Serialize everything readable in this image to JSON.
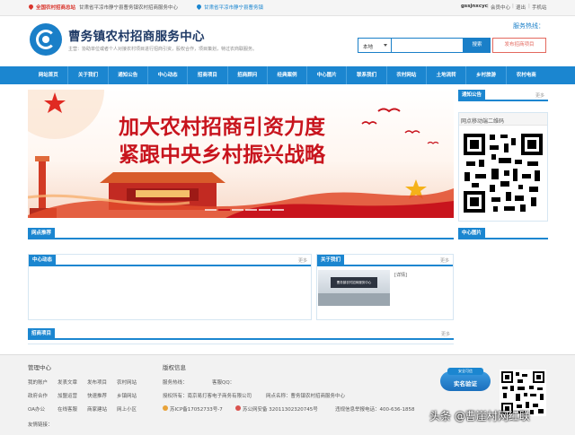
{
  "topbar": {
    "badge": "全国农村招商总站",
    "region": "甘肃省平凉市静宁县曹务镇农村招商服务中心",
    "location": "甘肃省平凉市静宁县曹务镇",
    "username": "gssjnxcyc",
    "links": [
      "会员中心",
      "退出",
      "手机站"
    ],
    "sep": "|"
  },
  "header": {
    "site_name": "曹务镇农村招商服务中心",
    "slogan": "主营：协助单位或者个人对接农村项目进行招商引资，股权合作，项目策划，特过农商联服务。",
    "hotline_label": "服务热线：",
    "publish_button": "发布招商项目"
  },
  "search": {
    "scope": "本地",
    "button": "搜索"
  },
  "nav": [
    "网站首页",
    "关于我们",
    "通知公告",
    "中心动态",
    "招商项目",
    "招商顾问",
    "经典案例",
    "中心图片",
    "联系我们",
    "农村网站",
    "土地流转",
    "乡村旅游",
    "农村电商"
  ],
  "banner": {
    "line1": "加大农村招商引资力度",
    "line2": "紧跟中央乡村振兴战略"
  },
  "sidebar": {
    "notice_title": "通知公告",
    "notice_more": "更多",
    "qr_title": "网点移动端二维码",
    "photos_title": "中心图片"
  },
  "sections": {
    "recommend_title": "网点推荐",
    "news_title": "中心动态",
    "news_more": "更多",
    "about_title": "关于我们",
    "about_more": "更多",
    "about_detail": "[详情]",
    "about_photo_caption": "曹务镇农村招商服务中心",
    "projects_title": "招商项目",
    "projects_more": "更多"
  },
  "footer": {
    "mgmt_title": "管理中心",
    "mgmt_links": [
      [
        "我的账户",
        "发表文章",
        "发布项目",
        "农村网站"
      ],
      [
        "政府合作",
        "加盟运营",
        "快速推荐",
        "乡镇网站"
      ],
      [
        "OA办公",
        "在线客服",
        "商家建站",
        "网上小区"
      ]
    ],
    "friend_links": "友情链接：",
    "copyright_title": "版权信息",
    "hotline": "服务热线：",
    "qq": "客服QQ：",
    "company": "授权所有：南京易打客电子商务有限公司",
    "site_name": "网点名称：曹务镇农村招商服务中心",
    "icp": "苏ICP备17052733号-7",
    "police": "苏公网安备 32011302320745号",
    "report": "违规信息举报电话：400-636-1858",
    "badge_text": "实名验证",
    "badge_top": "安全可信"
  },
  "watermark": "头条 @曹崖村网红联",
  "colors": {
    "primary": "#1b86d0",
    "accent": "#e3685e",
    "banner_red": "#c8141d"
  }
}
